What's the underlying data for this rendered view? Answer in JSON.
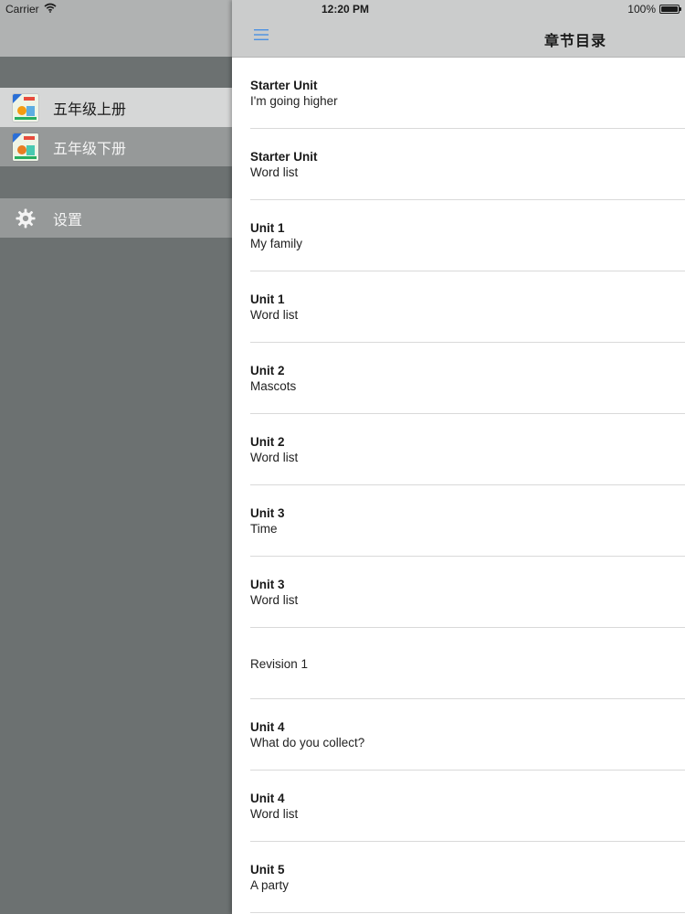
{
  "status_bar": {
    "carrier": "Carrier",
    "time": "12:20 PM",
    "battery": "100%",
    "battery_level": 1.0
  },
  "sidebar": {
    "items": [
      {
        "label": "五年级上册",
        "icon": "book-cover-icon",
        "selected": true
      },
      {
        "label": "五年级下册",
        "icon": "book-cover-icon",
        "selected": false
      },
      {
        "label": "设置",
        "icon": "gear-icon",
        "selected": false
      }
    ]
  },
  "header": {
    "title": "章节目录",
    "menu_icon": "hamburger-menu-icon"
  },
  "chapters": [
    {
      "title": "Starter Unit",
      "subtitle": "I'm going higher"
    },
    {
      "title": "Starter Unit",
      "subtitle": "Word list"
    },
    {
      "title": "Unit 1",
      "subtitle": "My family"
    },
    {
      "title": "Unit 1",
      "subtitle": "Word list"
    },
    {
      "title": "Unit 2",
      "subtitle": "Mascots"
    },
    {
      "title": "Unit 2",
      "subtitle": "Word list"
    },
    {
      "title": "Unit 3",
      "subtitle": "Time"
    },
    {
      "title": "Unit 3",
      "subtitle": "Word list"
    },
    {
      "title": "",
      "subtitle": "Revision 1"
    },
    {
      "title": "Unit 4",
      "subtitle": "What do you collect?"
    },
    {
      "title": "Unit 4",
      "subtitle": "Word list"
    },
    {
      "title": "Unit 5",
      "subtitle": "A party"
    }
  ],
  "colors": {
    "accent": "#4a90e2",
    "sidebar_bg": "#6c7171",
    "sidebar_selected": "#d6d7d7",
    "header_bg": "#cbcccc"
  }
}
